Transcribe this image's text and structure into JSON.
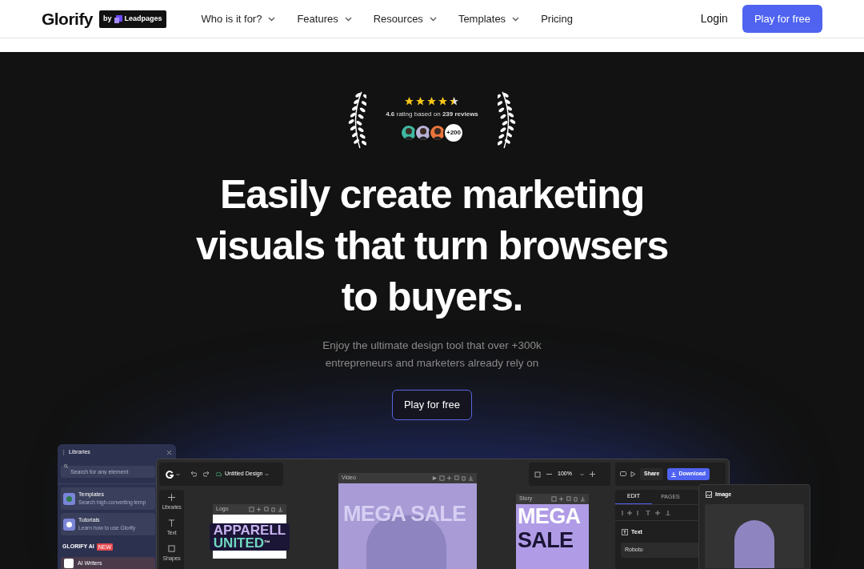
{
  "nav": {
    "logo": "Glorify",
    "badge_by": "by",
    "badge_brand": "Leadpages",
    "menu": [
      {
        "label": "Who is it for?",
        "dropdown": true
      },
      {
        "label": "Features",
        "dropdown": true
      },
      {
        "label": "Resources",
        "dropdown": true
      },
      {
        "label": "Templates",
        "dropdown": true
      },
      {
        "label": "Pricing",
        "dropdown": false
      }
    ],
    "login": "Login",
    "cta": "Play for free"
  },
  "hero": {
    "stars": 4.5,
    "rating": "**4.6** rating based on **239 reviews**",
    "avatars": [
      {
        "color": "#3fb8a0"
      },
      {
        "color": "#b9b2d8"
      },
      {
        "color": "#e8743b"
      }
    ],
    "more_count": "+200",
    "headline": "Easily create marketing visuals that turn browsers to buyers.",
    "subtitle": "Enjoy the ultimate design tool that over +300k entrepreneurs and marketers already rely on",
    "cta": "Play for free"
  },
  "app": {
    "libraries": {
      "title": "Libraries",
      "search_placeholder": "Search for any element",
      "items": [
        {
          "title": "Templates",
          "subtitle": "Search high-converting temp"
        },
        {
          "title": "Tutorials",
          "subtitle": "Learn how to use Glorify"
        }
      ],
      "section": "GLORIFY AI",
      "section_badge": "NEW",
      "ai_item": "AI Writers"
    },
    "doc_name": "Untitled Design",
    "tools": [
      {
        "label": "Libraries",
        "kind": "plus"
      },
      {
        "label": "Text",
        "kind": "text"
      },
      {
        "label": "Shapes",
        "kind": "square"
      }
    ],
    "logo_frame": {
      "label": "Logo",
      "line1": "APPARELL",
      "line2": "UNITED",
      "mark": "™"
    },
    "video_frame": {
      "label": "Video",
      "text": "MEGA SALE"
    },
    "story_frame": {
      "label": "Story",
      "line1": "MEGA",
      "line2": "SALE"
    },
    "zoom": "100%",
    "share": "Share",
    "download": "Download",
    "tabs": [
      {
        "label": "EDIT",
        "selected": true
      },
      {
        "label": "PAGES",
        "selected": false
      }
    ],
    "text_section": "Text",
    "font": "Roboto",
    "image_panel": {
      "title": "Image"
    }
  }
}
